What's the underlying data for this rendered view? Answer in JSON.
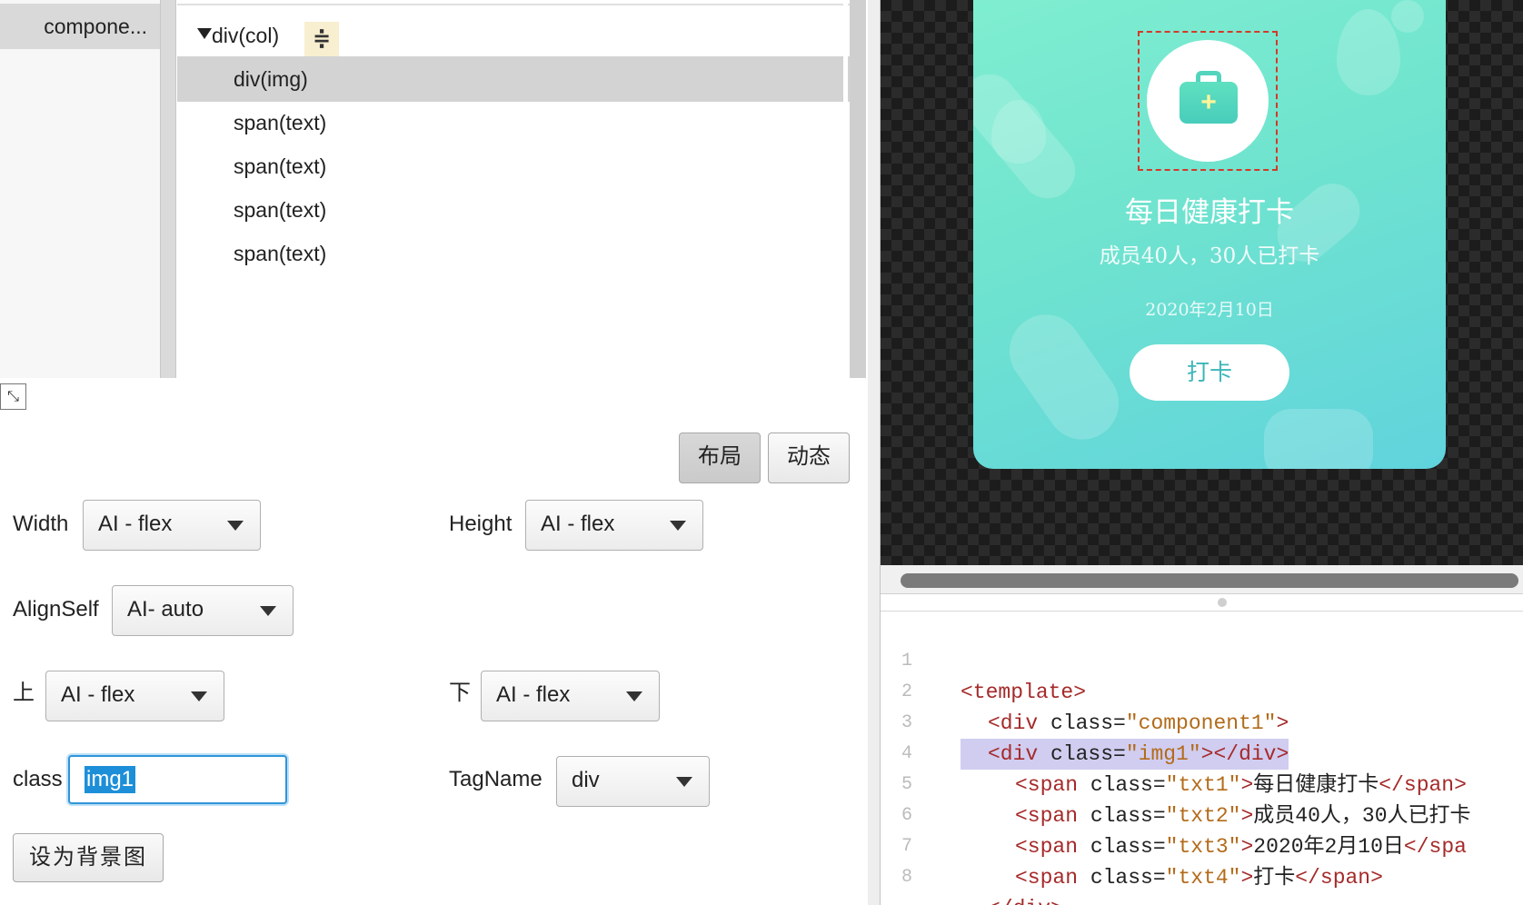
{
  "components": {
    "item_label": "compone..."
  },
  "tree": {
    "root_label": "div(col)",
    "root_badge": "≑",
    "children": [
      "div(img)",
      "span(text)",
      "span(text)",
      "span(text)",
      "span(text)"
    ]
  },
  "tabs": {
    "layout": "布局",
    "dynamic": "动态"
  },
  "props": {
    "width_label": "Width",
    "width_value": "AI - flex",
    "height_label": "Height",
    "height_value": "AI - flex",
    "alignself_label": "AlignSelf",
    "alignself_value": "AI- auto",
    "top_label": "上",
    "top_value": "AI - flex",
    "bottom_label": "下",
    "bottom_value": "AI - flex",
    "class_label": "class",
    "class_value": "img1",
    "tagname_label": "TagName",
    "tagname_value": "div",
    "bg_button": "设为背景图"
  },
  "preview": {
    "title": "每日健康打卡",
    "subtitle": "成员40人，30人已打卡",
    "date": "2020年2月10日",
    "button": "打卡",
    "kit_plus": "+"
  },
  "code": {
    "line_numbers": [
      "1",
      "2",
      "3",
      "4",
      "5",
      "6",
      "7",
      "8"
    ],
    "l1": {
      "open": "<template>"
    },
    "l2": {
      "open": "<div ",
      "attr": "class=",
      "val": "\"component1\"",
      "close": ">"
    },
    "l3": {
      "open": "<div ",
      "attr": "class=",
      "val": "\"img1\"",
      "close": "></div>"
    },
    "l4": {
      "open": "<span ",
      "attr": "class=",
      "val": "\"txt1\"",
      "close": ">",
      "text": "每日健康打卡",
      "end": "</span>"
    },
    "l5": {
      "open": "<span ",
      "attr": "class=",
      "val": "\"txt2\"",
      "close": ">",
      "text": "成员40人，30人已打卡",
      "end": ""
    },
    "l6": {
      "open": "<span ",
      "attr": "class=",
      "val": "\"txt3\"",
      "close": ">",
      "text": "2020年2月10日",
      "end": "</spa"
    },
    "l7": {
      "open": "<span ",
      "attr": "class=",
      "val": "\"txt4\"",
      "close": ">",
      "text": "打卡",
      "end": "</span>"
    },
    "l8": {
      "open": "</div>"
    }
  },
  "colors": {
    "accent": "#2f95d8",
    "card_start": "#7feed0",
    "card_end": "#60d3dd",
    "selection": "#d23a2a",
    "code_tag": "#a52a2a",
    "code_string": "#b36b1a",
    "code_highlight": "#d0cdf0"
  }
}
